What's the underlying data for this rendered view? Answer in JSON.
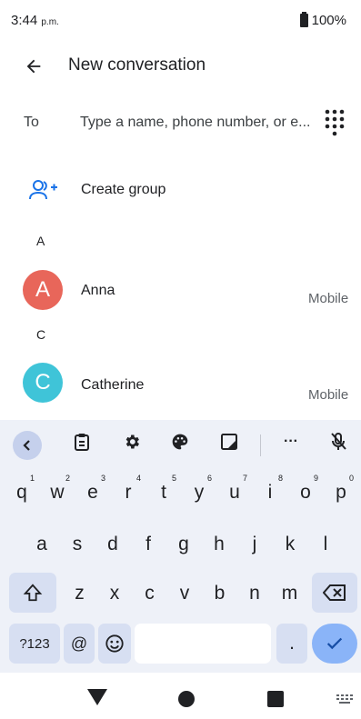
{
  "status_bar": {
    "time": "3:44",
    "ampm": "p.m.",
    "battery": "100%"
  },
  "app_bar": {
    "title": "New conversation"
  },
  "to_field": {
    "label": "To",
    "placeholder": "Type a name, phone number, or e..."
  },
  "create_group": {
    "label": "Create group"
  },
  "sections": [
    {
      "letter": "A",
      "contacts": [
        {
          "initial": "A",
          "name": "Anna",
          "type": "Mobile",
          "color": "#e8665a"
        }
      ]
    },
    {
      "letter": "C",
      "contacts": [
        {
          "initial": "C",
          "name": "Catherine",
          "type": "Mobile",
          "color": "#3fc4d8"
        }
      ]
    }
  ],
  "keyboard": {
    "row1": [
      {
        "k": "q",
        "n": "1"
      },
      {
        "k": "w",
        "n": "2"
      },
      {
        "k": "e",
        "n": "3"
      },
      {
        "k": "r",
        "n": "4"
      },
      {
        "k": "t",
        "n": "5"
      },
      {
        "k": "y",
        "n": "6"
      },
      {
        "k": "u",
        "n": "7"
      },
      {
        "k": "i",
        "n": "8"
      },
      {
        "k": "o",
        "n": "9"
      },
      {
        "k": "p",
        "n": "0"
      }
    ],
    "row2": [
      "a",
      "s",
      "d",
      "f",
      "g",
      "h",
      "j",
      "k",
      "l"
    ],
    "row3": [
      "z",
      "x",
      "c",
      "v",
      "b",
      "n",
      "m"
    ],
    "symbols_label": "?123",
    "at_label": "@",
    "period_label": ".",
    "toolbar_more": "···"
  },
  "colors": {
    "accent": "#1a73e8",
    "key_special": "#d7dff2",
    "enter": "#8ab4f8",
    "keyboard_bg": "#eef1f8"
  }
}
